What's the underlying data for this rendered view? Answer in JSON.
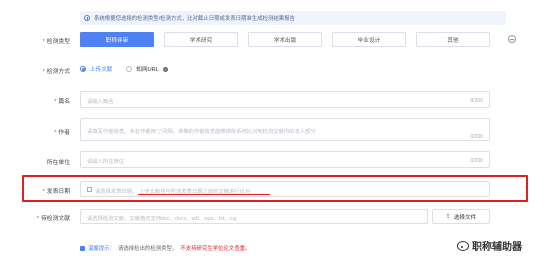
{
  "notice": "系统根据您选择的检测类型/检测方式，比对截止日期或发表日期准生成检测结果报告",
  "form": {
    "detect_type": {
      "label": "检测类型",
      "options": [
        "职称评审",
        "学术研究",
        "学术出版",
        "毕业设计",
        "其他"
      ],
      "selected": "职称评审"
    },
    "detect_method": {
      "label": "检测方式",
      "options": [
        "上传文献",
        "知网URL"
      ],
      "selected": "上传文献"
    },
    "title": {
      "label": "篇名",
      "placeholder": "请输入篇名",
      "count": "0/200"
    },
    "author": {
      "label": "作者",
      "placeholder": "请填写作者信息。多名作者用“；”间隔，准确的作者信息能够排除系统比对到检测文献内的本人部分",
      "count": "0/200"
    },
    "unit": {
      "label": "所在单位",
      "placeholder": "请输入所在单位",
      "count": "0/200"
    },
    "publish_date": {
      "label": "发表日期",
      "placeholder": "请选择发表日期。",
      "hint": "上传文献将与所选发表日期之前的文献进行比对"
    },
    "upload": {
      "label": "待检测文献",
      "placeholder": "请选择检测文献，文献格式支持doc、docx、pdf、wps、txt、caj",
      "button": "选择文件"
    }
  },
  "warning": {
    "key": "温馨提示：",
    "text": "请选择检出的检测类型，",
    "red": "不支持研究生学位论文查重。"
  },
  "watermark": "职称辅助器",
  "colors": {
    "accent": "#4e82f3",
    "highlight": "#e02020"
  }
}
